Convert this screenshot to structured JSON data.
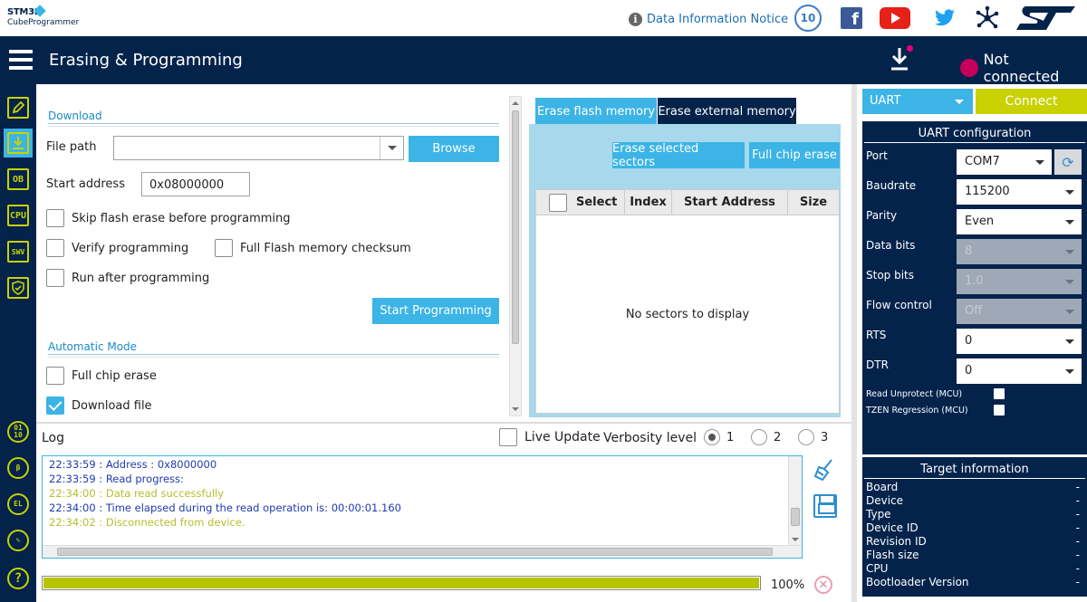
{
  "brand": {
    "line1": "STM32",
    "line2": "CubeProgrammer"
  },
  "topbar": {
    "notice": "Data Information Notice",
    "anniversary": "10",
    "facebook": "f",
    "twitter": "🐦",
    "st": "ST"
  },
  "header": {
    "title": "Erasing & Programming",
    "status": "Not connected"
  },
  "sidebar": {
    "top_items": [
      {
        "label": "",
        "icon": "pencil-icon"
      },
      {
        "label": "",
        "icon": "download-icon"
      },
      {
        "label": "OB",
        "icon": "option-bytes-icon"
      },
      {
        "label": "CPU",
        "icon": "cpu-icon"
      },
      {
        "label": "SWV",
        "icon": "swv-icon"
      },
      {
        "label": "",
        "icon": "shield-icon"
      }
    ],
    "bottom_items": [
      {
        "label": "01 10",
        "icon": "binary-icon"
      },
      {
        "label": "",
        "icon": "beta-icon"
      },
      {
        "label": "EL",
        "icon": "external-loader-icon"
      },
      {
        "label": "",
        "icon": "tools-icon"
      },
      {
        "label": "?",
        "icon": "help-icon"
      }
    ]
  },
  "download": {
    "section": "Download",
    "file_path_label": "File path",
    "file_path_value": "",
    "browse": "Browse",
    "start_address_label": "Start address",
    "start_address_value": "0x08000000",
    "skip_erase": "Skip flash erase before programming",
    "verify": "Verify programming",
    "full_checksum": "Full Flash memory checksum",
    "run_after": "Run after programming",
    "start_programming": "Start Programming"
  },
  "automatic": {
    "section": "Automatic Mode",
    "full_chip_erase": "Full chip erase",
    "download_file": "Download file",
    "download_file_checked": true
  },
  "erase": {
    "tab_flash": "Erase flash memory",
    "tab_external": "Erase external memory",
    "erase_selected": "Erase selected sectors",
    "full_chip_erase": "Full chip erase",
    "columns": [
      "Select",
      "Index",
      "Start Address",
      "Size"
    ],
    "empty": "No sectors to display"
  },
  "log": {
    "title": "Log",
    "live_update": "Live Update",
    "verbosity_label": "Verbosity level",
    "levels": [
      "1",
      "2",
      "3"
    ],
    "selected_level": "1",
    "lines": [
      {
        "text": "22:33:59 :   Address       : 0x8000000",
        "color": "blue"
      },
      {
        "text": "22:33:59 : Read progress:",
        "color": "blue"
      },
      {
        "text": "22:34:00 : Data read successfully",
        "color": "yellow"
      },
      {
        "text": "22:34:00 : Time elapsed during the read operation is: 00:00:01.160",
        "color": "blue"
      },
      {
        "text": "22:34:02 : Disconnected from device.",
        "color": "yellow"
      }
    ],
    "progress_percent": 100,
    "progress_text": "100%"
  },
  "connection": {
    "interface": "UART",
    "connect": "Connect",
    "config_title": "UART configuration",
    "fields": [
      {
        "label": "Port",
        "value": "COM7",
        "disabled": false
      },
      {
        "label": "Baudrate",
        "value": "115200",
        "disabled": false
      },
      {
        "label": "Parity",
        "value": "Even",
        "disabled": false
      },
      {
        "label": "Data bits",
        "value": "8",
        "disabled": true
      },
      {
        "label": "Stop bits",
        "value": "1.0",
        "disabled": true
      },
      {
        "label": "Flow control",
        "value": "Off",
        "disabled": true
      },
      {
        "label": "RTS",
        "value": "0",
        "disabled": false
      },
      {
        "label": "DTR",
        "value": "0",
        "disabled": false
      }
    ],
    "read_unprotect": "Read Unprotect (MCU)",
    "tzen_regression": "TZEN Regression (MCU)"
  },
  "target": {
    "title": "Target information",
    "rows": [
      {
        "label": "Board",
        "value": "-"
      },
      {
        "label": "Device",
        "value": "-"
      },
      {
        "label": "Type",
        "value": "-"
      },
      {
        "label": "Device ID",
        "value": "-"
      },
      {
        "label": "Revision ID",
        "value": "-"
      },
      {
        "label": "Flash size",
        "value": "-"
      },
      {
        "label": "CPU",
        "value": "-"
      },
      {
        "label": "Bootloader Version",
        "value": "-"
      }
    ]
  },
  "colors": {
    "navy": "#03234b",
    "accent_blue": "#3cb4e6",
    "accent_lime": "#c9d200",
    "status_red": "#c4005a"
  }
}
